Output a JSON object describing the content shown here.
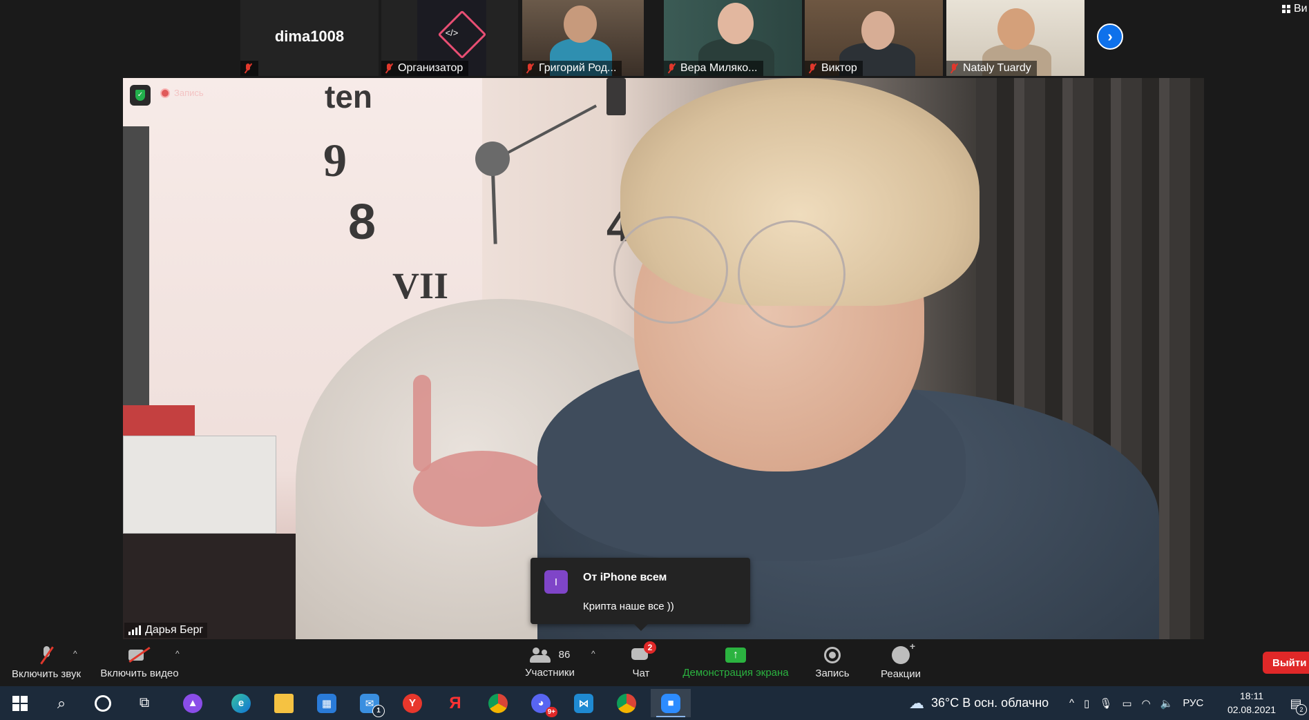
{
  "thumbnails": [
    {
      "name": "dima1008",
      "label": "",
      "type": "text"
    },
    {
      "name": "Организатор",
      "type": "logo",
      "logo_text": "</>"
    },
    {
      "name": "Григорий Род...",
      "type": "photo"
    },
    {
      "name": "Вера Миляко...",
      "type": "photo"
    },
    {
      "name": "Виктор",
      "type": "photo"
    },
    {
      "name": "Nataly Tuardy",
      "type": "photo"
    }
  ],
  "top_right": {
    "view_label": "Ви"
  },
  "main_video": {
    "speaker_name": "Дарья Берг",
    "recording_label": "Запись",
    "clock_numbers": [
      "ten",
      "9",
      "8",
      "VII",
      "4"
    ]
  },
  "chat_toast": {
    "avatar_letter": "I",
    "from": "От iPhone всем",
    "message": "Крипта наше все ))"
  },
  "toolbar": {
    "unmute_label": "Включить звук",
    "video_label": "Включить видео",
    "participants_count": "86",
    "participants_label": "Участники",
    "chat_label": "Чат",
    "chat_badge": "2",
    "share_label": "Демонстрация экрана",
    "record_label": "Запись",
    "reactions_label": "Реакции",
    "leave_label": "Выйти",
    "share_color": "#2bb340",
    "leave_color": "#e02828"
  },
  "taskbar": {
    "apps": [
      "start",
      "search",
      "cortana",
      "task-view",
      "alice",
      "edge",
      "explorer",
      "store",
      "mail",
      "yandex-browser",
      "yandex",
      "chrome",
      "discord",
      "vscode",
      "chrome-profile",
      "zoom"
    ],
    "mail_badge": "1",
    "discord_badge": "9+",
    "weather": "36°C  В осн. облачно",
    "language": "РУС",
    "time": "18:11",
    "date": "02.08.2021",
    "notifications_badge": "2"
  }
}
